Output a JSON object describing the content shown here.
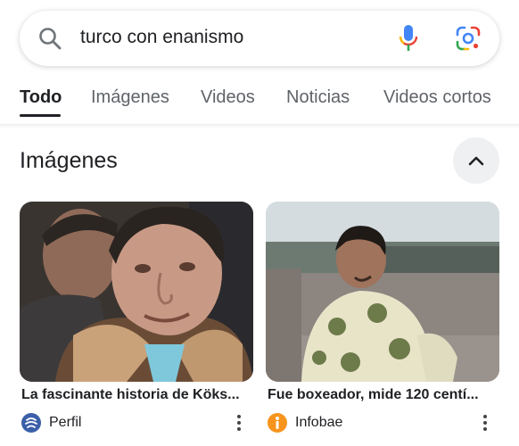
{
  "search": {
    "query": "turco con enanismo"
  },
  "tabs": [
    {
      "label": "Todo",
      "active": true
    },
    {
      "label": "Imágenes",
      "active": false
    },
    {
      "label": "Videos",
      "active": false
    },
    {
      "label": "Noticias",
      "active": false
    },
    {
      "label": "Videos cortos",
      "active": false
    }
  ],
  "images_section": {
    "title": "Imágenes",
    "cards": [
      {
        "title": "La fascinante historia de Köks...",
        "source": "Perfil",
        "source_icon": "perfil-logo-icon",
        "source_color": "#3b5fa8"
      },
      {
        "title": "Fue boxeador, mide 120 centí...",
        "source": "Infobae",
        "source_icon": "infobae-logo-icon",
        "source_color": "#f7941d"
      }
    ]
  },
  "colors": {
    "google_blue": "#4285F4",
    "google_red": "#EA4335",
    "google_yellow": "#FBBC05",
    "google_green": "#34A853"
  }
}
